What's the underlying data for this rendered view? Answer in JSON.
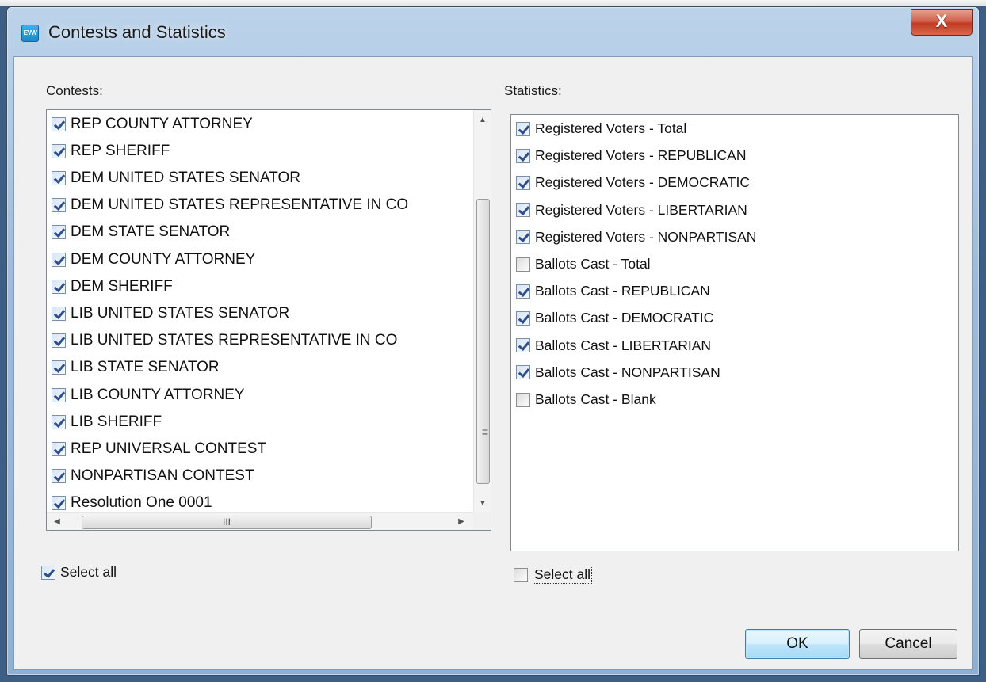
{
  "window": {
    "title": "Contests and Statistics",
    "icon_label": "EVW",
    "close_label": "X"
  },
  "contests": {
    "label": "Contests:",
    "items": [
      {
        "label": "REP COUNTY ATTORNEY",
        "checked": true
      },
      {
        "label": "REP SHERIFF",
        "checked": true
      },
      {
        "label": "DEM UNITED STATES SENATOR",
        "checked": true
      },
      {
        "label": "DEM UNITED STATES REPRESENTATIVE IN CO",
        "checked": true
      },
      {
        "label": "DEM STATE SENATOR",
        "checked": true
      },
      {
        "label": "DEM COUNTY ATTORNEY",
        "checked": true
      },
      {
        "label": "DEM SHERIFF",
        "checked": true
      },
      {
        "label": "LIB UNITED STATES SENATOR",
        "checked": true
      },
      {
        "label": "LIB UNITED STATES REPRESENTATIVE IN CO",
        "checked": true
      },
      {
        "label": "LIB STATE SENATOR",
        "checked": true
      },
      {
        "label": "LIB COUNTY ATTORNEY",
        "checked": true
      },
      {
        "label": "LIB SHERIFF",
        "checked": true
      },
      {
        "label": "REP UNIVERSAL CONTEST",
        "checked": true
      },
      {
        "label": "NONPARTISAN CONTEST",
        "checked": true
      },
      {
        "label": "Resolution One 0001",
        "checked": true
      }
    ],
    "select_all_label": "Select all",
    "select_all_checked": true,
    "hscroll_grip": "III",
    "vscroll_grip": "≡"
  },
  "statistics": {
    "label": "Statistics:",
    "items": [
      {
        "label": "Registered Voters - Total",
        "checked": true
      },
      {
        "label": "Registered Voters - REPUBLICAN",
        "checked": true
      },
      {
        "label": "Registered Voters - DEMOCRATIC",
        "checked": true
      },
      {
        "label": "Registered Voters - LIBERTARIAN",
        "checked": true
      },
      {
        "label": "Registered Voters - NONPARTISAN",
        "checked": true
      },
      {
        "label": "Ballots Cast - Total",
        "checked": false
      },
      {
        "label": "Ballots Cast - REPUBLICAN",
        "checked": true
      },
      {
        "label": "Ballots Cast - DEMOCRATIC",
        "checked": true
      },
      {
        "label": "Ballots Cast - LIBERTARIAN",
        "checked": true
      },
      {
        "label": "Ballots Cast - NONPARTISAN",
        "checked": true
      },
      {
        "label": "Ballots Cast - Blank",
        "checked": false
      }
    ],
    "select_all_label": "Select all",
    "select_all_checked": false
  },
  "buttons": {
    "ok": "OK",
    "cancel": "Cancel"
  }
}
